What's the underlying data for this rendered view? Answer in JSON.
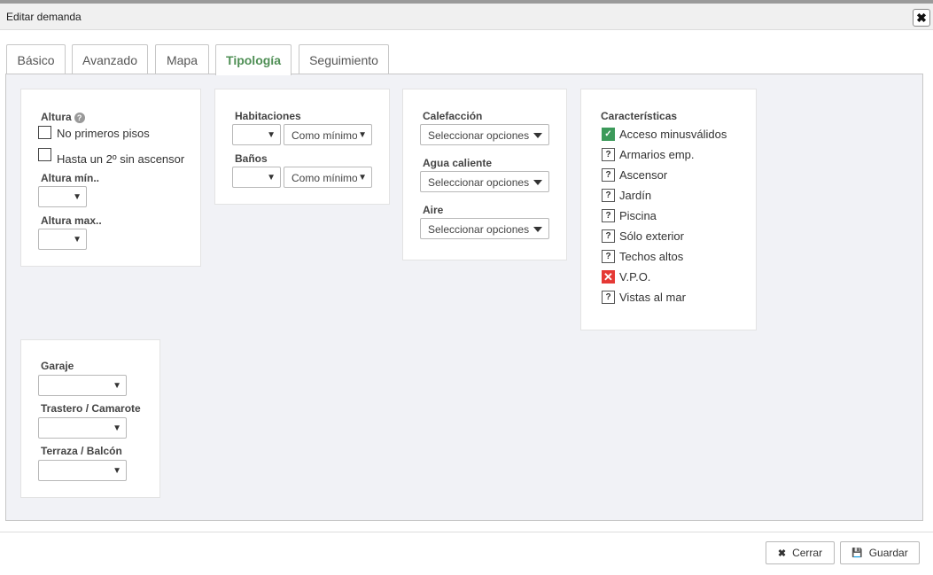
{
  "window": {
    "title": "Editar demanda",
    "close_symbol": "✖"
  },
  "tabs": [
    {
      "label": "Básico"
    },
    {
      "label": "Avanzado"
    },
    {
      "label": "Mapa"
    },
    {
      "label": "Tipología"
    },
    {
      "label": "Seguimiento"
    }
  ],
  "active_tab": "Tipología",
  "altura": {
    "label": "Altura",
    "help_symbol": "?",
    "no_primeros_pisos": {
      "label": "No primeros pisos",
      "checked": false
    },
    "hasta_segundo": {
      "label": "Hasta un 2º sin ascensor",
      "checked": false
    },
    "altura_min": {
      "label": "Altura mín..",
      "value": ""
    },
    "altura_max": {
      "label": "Altura max..",
      "value": ""
    }
  },
  "habitaciones": {
    "label": "Habitaciones",
    "value": "",
    "modifier": "Como mínimo"
  },
  "banos": {
    "label": "Baños",
    "value": "",
    "modifier": "Como mínimo"
  },
  "calefaccion": {
    "label": "Calefacción",
    "placeholder": "Seleccionar opciones"
  },
  "agua_caliente": {
    "label": "Agua caliente",
    "placeholder": "Seleccionar opciones"
  },
  "aire": {
    "label": "Aire",
    "placeholder": "Seleccionar opciones"
  },
  "caracteristicas": {
    "label": "Características",
    "items": [
      {
        "label": "Acceso minusválidos",
        "state": "yes",
        "symbol": "✓"
      },
      {
        "label": "Armarios emp.",
        "state": "unknown",
        "symbol": "?"
      },
      {
        "label": "Ascensor",
        "state": "unknown",
        "symbol": "?"
      },
      {
        "label": "Jardín",
        "state": "unknown",
        "symbol": "?"
      },
      {
        "label": "Piscina",
        "state": "unknown",
        "symbol": "?"
      },
      {
        "label": "Sólo exterior",
        "state": "unknown",
        "symbol": "?"
      },
      {
        "label": "Techos altos",
        "state": "unknown",
        "symbol": "?"
      },
      {
        "label": "V.P.O.",
        "state": "no",
        "symbol": "✕"
      },
      {
        "label": "Vistas al mar",
        "state": "unknown",
        "symbol": "?"
      }
    ]
  },
  "garaje": {
    "label": "Garaje",
    "value": ""
  },
  "trastero": {
    "label": "Trastero / Camarote",
    "value": ""
  },
  "terraza": {
    "label": "Terraza / Balcón",
    "value": ""
  },
  "buttons": {
    "cerrar": {
      "label": "Cerrar",
      "icon": "✖"
    },
    "guardar": {
      "label": "Guardar",
      "icon": "💾"
    }
  },
  "colors": {
    "active_tab_text": "#4f8f55",
    "panel_bg": "#f1f2f6",
    "check_yes": "#3c9a5a",
    "check_no": "#e53935"
  }
}
